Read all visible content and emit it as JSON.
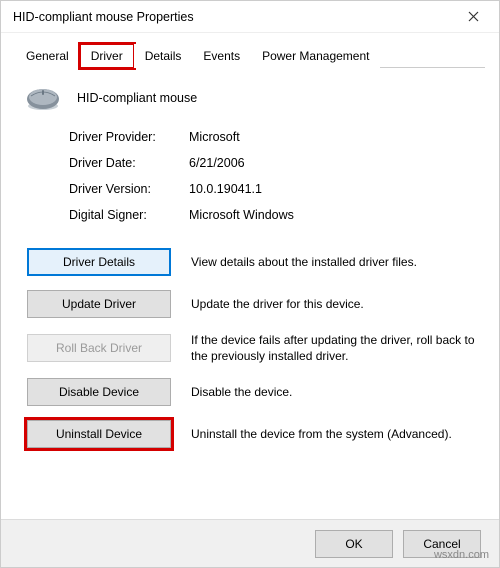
{
  "window": {
    "title": "HID-compliant mouse Properties"
  },
  "tabs": {
    "general": "General",
    "driver": "Driver",
    "details": "Details",
    "events": "Events",
    "power": "Power Management"
  },
  "device": {
    "name": "HID-compliant mouse"
  },
  "info": {
    "provider_label": "Driver Provider:",
    "provider_value": "Microsoft",
    "date_label": "Driver Date:",
    "date_value": "6/21/2006",
    "version_label": "Driver Version:",
    "version_value": "10.0.19041.1",
    "signer_label": "Digital Signer:",
    "signer_value": "Microsoft Windows"
  },
  "actions": {
    "details_btn": "Driver Details",
    "details_desc": "View details about the installed driver files.",
    "update_btn": "Update Driver",
    "update_desc": "Update the driver for this device.",
    "rollback_btn": "Roll Back Driver",
    "rollback_desc": "If the device fails after updating the driver, roll back to the previously installed driver.",
    "disable_btn": "Disable Device",
    "disable_desc": "Disable the device.",
    "uninstall_btn": "Uninstall Device",
    "uninstall_desc": "Uninstall the device from the system (Advanced)."
  },
  "footer": {
    "ok": "OK",
    "cancel": "Cancel"
  },
  "watermark": "wsxdn.com"
}
